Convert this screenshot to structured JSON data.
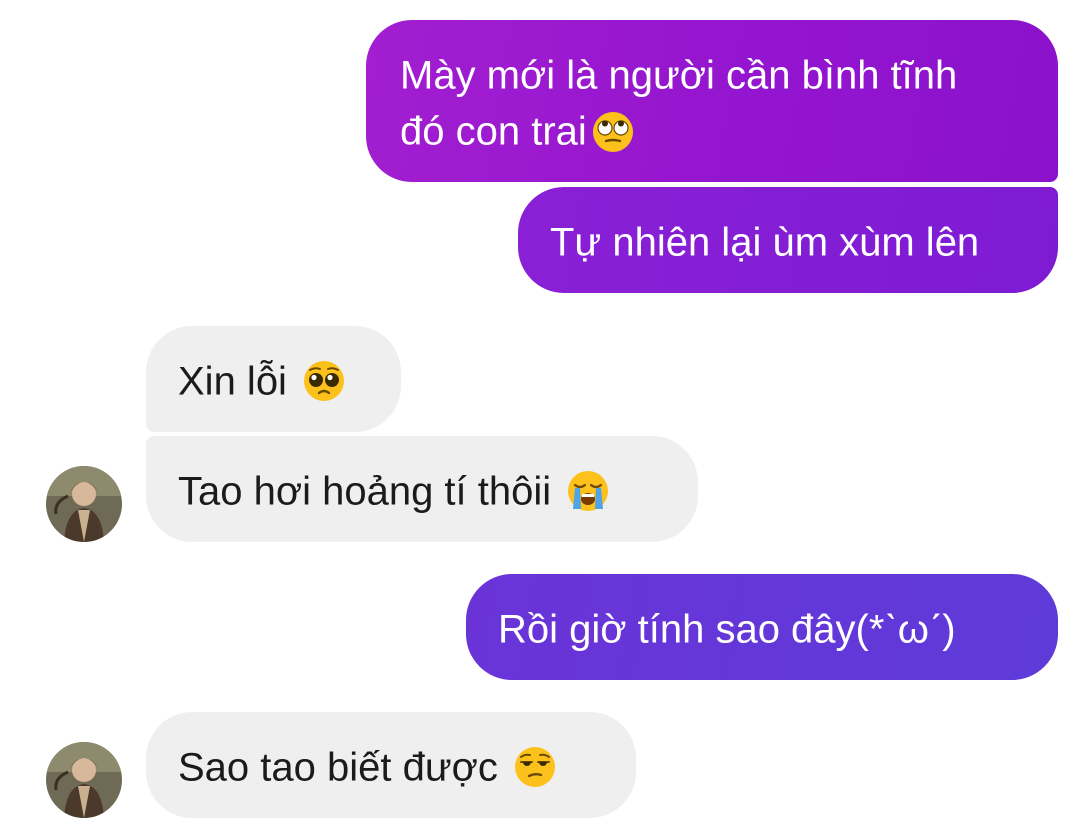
{
  "messages": [
    {
      "id": "msg1",
      "direction": "outgoing",
      "text_line1": "Mày mới là người cần bình tĩnh",
      "text_line2": "đó con trai",
      "emoji": "face-with-rolling-eyes-icon"
    },
    {
      "id": "msg2",
      "direction": "outgoing",
      "text": "Tự nhiên lại ùm xùm lên"
    },
    {
      "id": "msg3",
      "direction": "incoming",
      "text": "Xin lỗi",
      "emoji": "pleading-face-icon"
    },
    {
      "id": "msg4",
      "direction": "incoming",
      "text": "Tao hơi hoảng tí thôii",
      "emoji": "loudly-crying-face-icon"
    },
    {
      "id": "msg5",
      "direction": "outgoing",
      "text": "Rồi giờ tính sao đây(*ˋωˊ)"
    },
    {
      "id": "msg6",
      "direction": "incoming",
      "text": "Sao tao biết được",
      "emoji": "unamused-face-icon"
    }
  ],
  "colors": {
    "outgoing_top": "#9415cf",
    "outgoing_mid": "#7d1bd3",
    "outgoing_bottom": "#5e3bd8",
    "incoming_bubble": "#efefef",
    "incoming_text": "#1b1b1b",
    "outgoing_text": "#ffffff"
  }
}
